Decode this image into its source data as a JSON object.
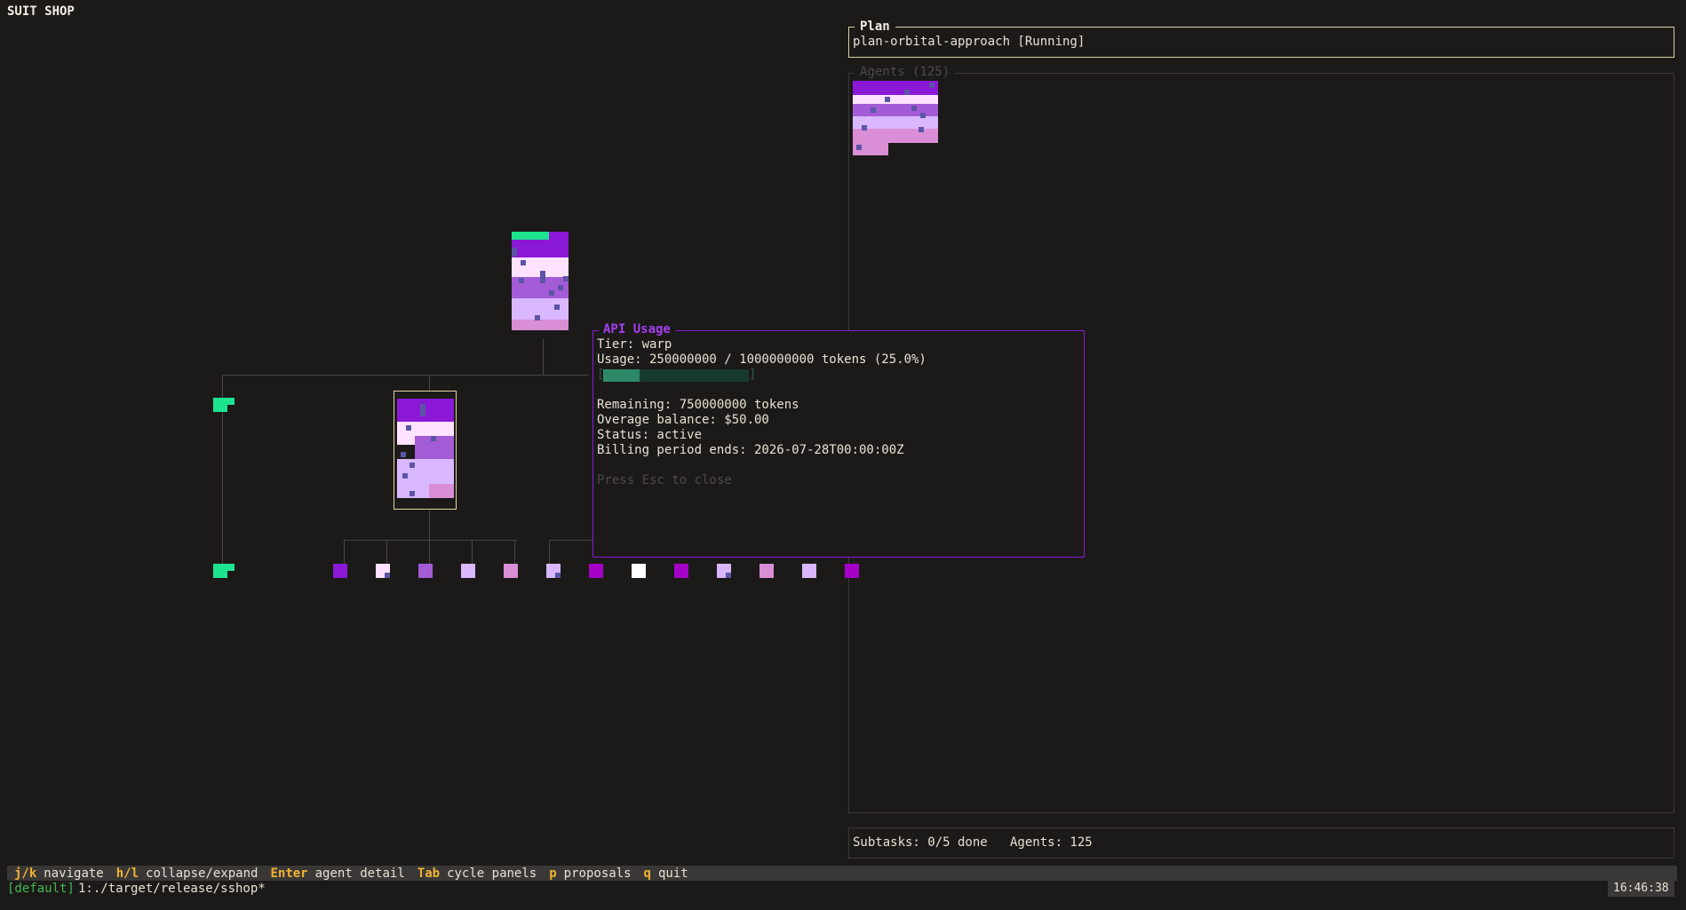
{
  "app": {
    "title": "SUIT SHOP"
  },
  "plan": {
    "legend": "Plan",
    "value": "plan-orbital-approach [Running]"
  },
  "agents": {
    "legend": "Agents (125)"
  },
  "subtasks": {
    "text": "Subtasks: 0/5 done   Agents: 125"
  },
  "api_usage": {
    "legend": "API Usage",
    "tier": "Tier: warp",
    "usage": "Usage: 250000000 / 1000000000 tokens (25.0%)",
    "usage_fraction": 0.25,
    "remaining": "Remaining: 750000000 tokens",
    "overage": "Overage balance: $50.00",
    "status": "Status: active",
    "billing": "Billing period ends: 2026-07-28T00:00:00Z",
    "hint": "Press Esc to close",
    "bar_open": "[",
    "bar_close": "]"
  },
  "help": [
    {
      "key": "j/k",
      "desc": "navigate"
    },
    {
      "key": "h/l",
      "desc": "collapse/expand"
    },
    {
      "key": "Enter",
      "desc": "agent detail"
    },
    {
      "key": "Tab",
      "desc": "cycle panels"
    },
    {
      "key": "p",
      "desc": "proposals"
    },
    {
      "key": "q",
      "desc": "quit"
    }
  ],
  "statusline": {
    "session": "[default]",
    "command": "1:./target/release/sshop*",
    "clock": "16:46:38"
  },
  "colors": {
    "accent_green": "#1de38f",
    "suit_purple": "#8a18d6",
    "suit_lavender": "#d9b8ff",
    "suit_pink": "#d98ed6",
    "key_orange": "#f2b431",
    "panel_border": "#d9d0a8"
  },
  "leaf_suit_colors": [
    "#8a18d6",
    "#ffe2ff",
    "#a35bd6",
    "#d9b8ff",
    "#d98ed6",
    "#d9b8ff",
    "#a600c8",
    "#ffffff",
    "#a600c8",
    "#d9b8ff",
    "#d98ed6",
    "#d9b8ff",
    "#a600c8"
  ]
}
